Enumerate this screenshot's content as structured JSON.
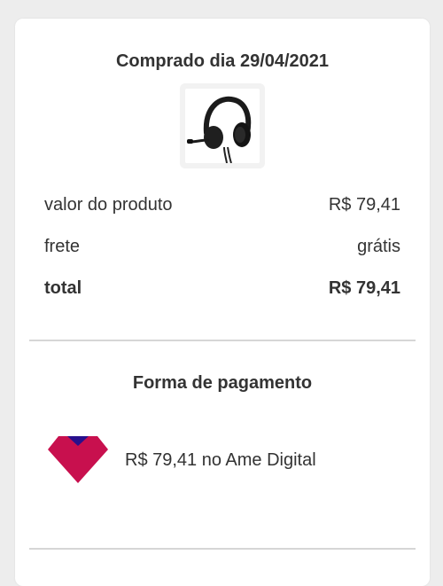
{
  "order": {
    "purchase_date": "Comprado dia 29/04/2021",
    "product_image_icon": "headset-icon"
  },
  "summary": {
    "product_value_label": "valor do produto",
    "product_value": "R$ 79,41",
    "shipping_label": "frete",
    "shipping_value": "grátis",
    "total_label": "total",
    "total_value": "R$ 79,41"
  },
  "payment": {
    "title": "Forma de pagamento",
    "method_icon": "ame-digital-logo-icon",
    "description": "R$ 79,41 no Ame Digital",
    "colors": {
      "brand_primary": "#c8104e",
      "brand_secondary": "#28108c"
    }
  }
}
